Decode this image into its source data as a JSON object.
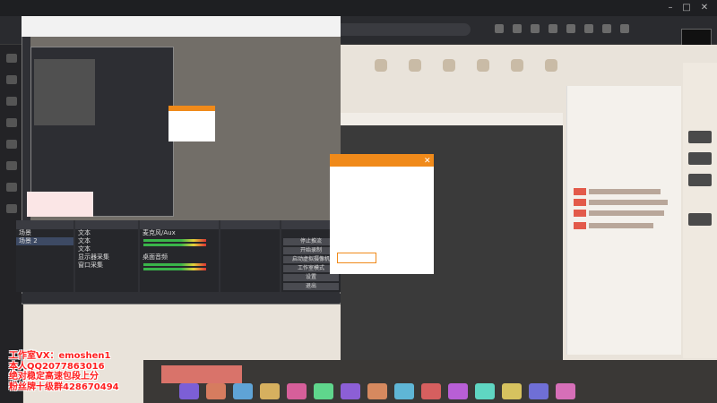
{
  "browser": {
    "title": "",
    "address": "",
    "brand_logo_text": "",
    "brand_logo_number": ""
  },
  "obs": {
    "title": "",
    "menu": "",
    "panel_scenes": "",
    "panel_sources": "",
    "panel_mixer": "",
    "panel_transitions": "",
    "panel_controls": "",
    "scenes": [
      "场景",
      "场景 2"
    ],
    "sources": [
      "文本",
      "文本",
      "文本",
      "显示器采集",
      "窗口采集"
    ],
    "mixer": [
      "麦克风/Aux",
      "桌面音频"
    ],
    "transition_value": "",
    "duration_label": "",
    "duration_value": "",
    "controls": [
      "停止推流",
      "开始录制",
      "启动虚拟摄像机",
      "工作室模式",
      "设置",
      "退出"
    ],
    "status": ""
  },
  "stream_dialog": {
    "line1": "",
    "line2": "",
    "line3": "",
    "line4": "",
    "button": ""
  },
  "promo": {
    "line1": "工作室VX：emoshen1",
    "line2": "本人QQ2077863016",
    "line3": "绝对稳定高速包段上分",
    "line4": "粉丝牌十级群428670494"
  },
  "colors": {
    "accent_orange": "#f08a1a",
    "promo_red": "#ff2020"
  }
}
